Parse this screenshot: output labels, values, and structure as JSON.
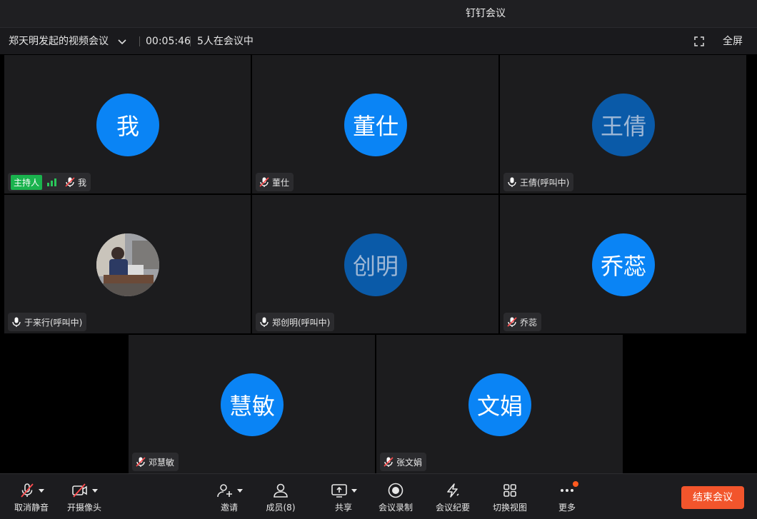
{
  "window": {
    "title": "钉钉会议"
  },
  "info": {
    "meeting_name": "郑天明发起的视频会议",
    "timer": "00:05:46",
    "participants": "5人在会议中",
    "fullscreen": "全屏"
  },
  "tiles": [
    {
      "avatar": "我",
      "label": "我",
      "host": "主持人",
      "mic": "muted"
    },
    {
      "avatar": "董仕",
      "label": "董仕",
      "mic": "muted"
    },
    {
      "avatar": "王倩",
      "label": "王倩(呼叫中)",
      "mic": "on"
    },
    {
      "avatar": "",
      "label": "于来行(呼叫中)",
      "mic": "on"
    },
    {
      "avatar": "创明",
      "label": "郑创明(呼叫中)",
      "mic": "on"
    },
    {
      "avatar": "乔蕊",
      "label": "乔蕊",
      "mic": "muted"
    },
    {
      "avatar": "慧敏",
      "label": "邓慧敏",
      "mic": "muted"
    },
    {
      "avatar": "文娟",
      "label": "张文娟",
      "mic": "muted"
    }
  ],
  "toolbar": {
    "unmute": "取消静音",
    "camera": "开摄像头",
    "invite": "邀请",
    "members": "成员(8)",
    "share": "共享",
    "record": "会议录制",
    "minutes": "会议纪要",
    "switch_view": "切换视图",
    "more": "更多",
    "end": "结束会议"
  },
  "colors": {
    "avatar_bright": "#0a84f5",
    "avatar_dim": "#0a5aa8",
    "host_badge": "#1ab34e",
    "end_button": "#f2552c"
  }
}
